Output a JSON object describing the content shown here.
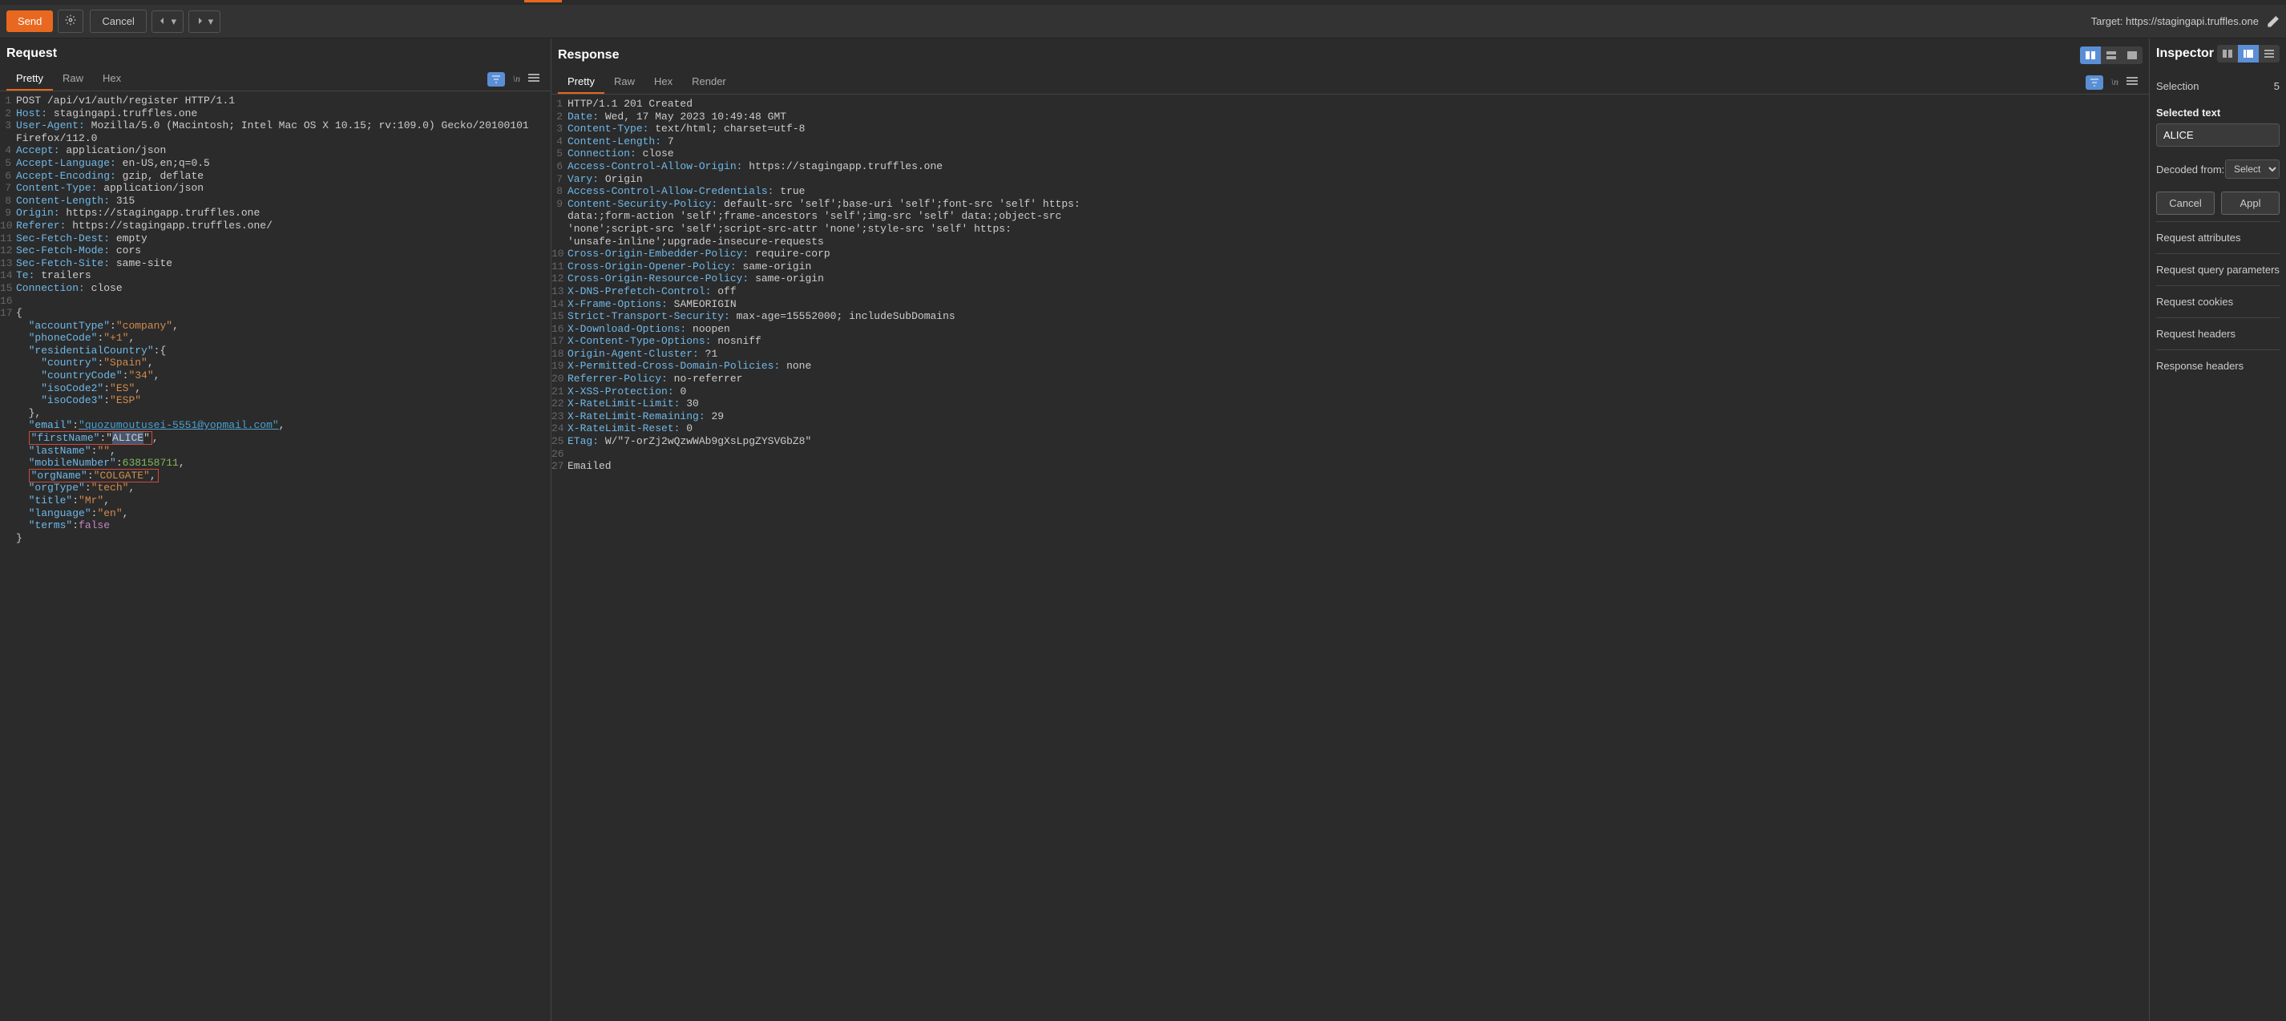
{
  "toolbar": {
    "send_label": "Send",
    "cancel_label": "Cancel",
    "target_label": "Target: https://stagingapi.truffles.one"
  },
  "request": {
    "title": "Request",
    "tabs": {
      "pretty": "Pretty",
      "raw": "Raw",
      "hex": "Hex"
    }
  },
  "response": {
    "title": "Response",
    "tabs": {
      "pretty": "Pretty",
      "raw": "Raw",
      "hex": "Hex",
      "render": "Render"
    }
  },
  "inspector": {
    "title": "Inspector",
    "selection_label": "Selection",
    "selection_count": "5",
    "selected_text_label": "Selected text",
    "selected_text_value": "ALICE",
    "decoded_from_label": "Decoded from:",
    "decoded_from_select": "Select",
    "cancel_label": "Cancel",
    "apply_label": "Appl",
    "sections": {
      "attrs": "Request attributes",
      "query": "Request query parameters",
      "cookies": "Request cookies",
      "req_headers": "Request headers",
      "res_headers": "Response headers"
    }
  },
  "req_lines": [
    {
      "n": "1",
      "raw": "POST /api/v1/auth/register HTTP/1.1"
    },
    {
      "n": "2",
      "h": "Host",
      "v": "stagingapi.truffles.one"
    },
    {
      "n": "3",
      "h": "User-Agent",
      "v": "Mozilla/5.0 (Macintosh; Intel Mac OS X 10.15; rv:109.0) Gecko/20100101",
      "cont": "Firefox/112.0"
    },
    {
      "n": "4",
      "h": "Accept",
      "v": "application/json"
    },
    {
      "n": "5",
      "h": "Accept-Language",
      "v": "en-US,en;q=0.5"
    },
    {
      "n": "6",
      "h": "Accept-Encoding",
      "v": "gzip, deflate"
    },
    {
      "n": "7",
      "h": "Content-Type",
      "v": "application/json"
    },
    {
      "n": "8",
      "h": "Content-Length",
      "v": "315"
    },
    {
      "n": "9",
      "h": "Origin",
      "v": "https://stagingapp.truffles.one"
    },
    {
      "n": "10",
      "h": "Referer",
      "v": "https://stagingapp.truffles.one/"
    },
    {
      "n": "11",
      "h": "Sec-Fetch-Dest",
      "v": "empty"
    },
    {
      "n": "12",
      "h": "Sec-Fetch-Mode",
      "v": "cors"
    },
    {
      "n": "13",
      "h": "Sec-Fetch-Site",
      "v": "same-site"
    },
    {
      "n": "14",
      "h": "Te",
      "v": "trailers"
    },
    {
      "n": "15",
      "h": "Connection",
      "v": "close"
    },
    {
      "n": "16",
      "raw": ""
    },
    {
      "n": "17",
      "raw": "{"
    }
  ],
  "req_body": {
    "accountType": "company",
    "phoneCode": "+1",
    "residentialCountry": {
      "country": "Spain",
      "countryCode": "34",
      "isoCode2": "ES",
      "isoCode3": "ESP"
    },
    "email": "quozumoutusei-5551@yopmail.com",
    "firstName": "ALICE",
    "lastName": "",
    "mobileNumber": 638158711,
    "orgName": "COLGATE",
    "orgType": "tech",
    "title": "Mr",
    "language": "en",
    "terms": false
  },
  "res_lines": [
    {
      "n": "1",
      "raw": "HTTP/1.1 201 Created"
    },
    {
      "n": "2",
      "h": "Date",
      "v": "Wed, 17 May 2023 10:49:48 GMT"
    },
    {
      "n": "3",
      "h": "Content-Type",
      "v": "text/html; charset=utf-8"
    },
    {
      "n": "4",
      "h": "Content-Length",
      "v": "7"
    },
    {
      "n": "5",
      "h": "Connection",
      "v": "close"
    },
    {
      "n": "6",
      "h": "Access-Control-Allow-Origin",
      "v": "https://stagingapp.truffles.one"
    },
    {
      "n": "7",
      "h": "Vary",
      "v": "Origin"
    },
    {
      "n": "8",
      "h": "Access-Control-Allow-Credentials",
      "v": "true"
    },
    {
      "n": "9",
      "h": "Content-Security-Policy",
      "v": "default-src 'self';base-uri 'self';font-src 'self' https:",
      "cont": [
        "data:;form-action 'self';frame-ancestors 'self';img-src 'self' data:;object-src",
        "'none';script-src 'self';script-src-attr 'none';style-src 'self' https:",
        "'unsafe-inline';upgrade-insecure-requests"
      ]
    },
    {
      "n": "10",
      "h": "Cross-Origin-Embedder-Policy",
      "v": "require-corp"
    },
    {
      "n": "11",
      "h": "Cross-Origin-Opener-Policy",
      "v": "same-origin"
    },
    {
      "n": "12",
      "h": "Cross-Origin-Resource-Policy",
      "v": "same-origin"
    },
    {
      "n": "13",
      "h": "X-DNS-Prefetch-Control",
      "v": "off"
    },
    {
      "n": "14",
      "h": "X-Frame-Options",
      "v": "SAMEORIGIN"
    },
    {
      "n": "15",
      "h": "Strict-Transport-Security",
      "v": "max-age=15552000; includeSubDomains"
    },
    {
      "n": "16",
      "h": "X-Download-Options",
      "v": "noopen"
    },
    {
      "n": "17",
      "h": "X-Content-Type-Options",
      "v": "nosniff"
    },
    {
      "n": "18",
      "h": "Origin-Agent-Cluster",
      "v": "?1"
    },
    {
      "n": "19",
      "h": "X-Permitted-Cross-Domain-Policies",
      "v": "none"
    },
    {
      "n": "20",
      "h": "Referrer-Policy",
      "v": "no-referrer"
    },
    {
      "n": "21",
      "h": "X-XSS-Protection",
      "v": "0"
    },
    {
      "n": "22",
      "h": "X-RateLimit-Limit",
      "v": "30"
    },
    {
      "n": "23",
      "h": "X-RateLimit-Remaining",
      "v": "29"
    },
    {
      "n": "24",
      "h": "X-RateLimit-Reset",
      "v": "0"
    },
    {
      "n": "25",
      "h": "ETag",
      "v": "W/\"7-orZj2wQzwWAb9gXsLpgZYSVGbZ8\""
    },
    {
      "n": "26",
      "raw": ""
    },
    {
      "n": "27",
      "raw": "Emailed"
    }
  ]
}
